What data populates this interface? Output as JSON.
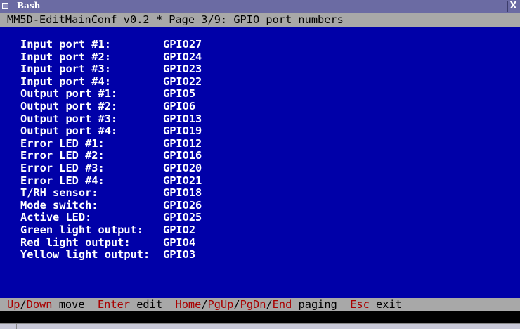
{
  "window": {
    "title": "Bash",
    "close_label": "X"
  },
  "header": {
    "title": "MM5D-EditMainConf v0.2 * Page 3/9: GPIO port numbers"
  },
  "rows": [
    {
      "label": "Input port #1:",
      "value": "GPIO27"
    },
    {
      "label": "Input port #2:",
      "value": "GPIO24"
    },
    {
      "label": "Input port #3:",
      "value": "GPIO23"
    },
    {
      "label": "Input port #4:",
      "value": "GPIO22"
    },
    {
      "label": "Output port #1:",
      "value": "GPIO5"
    },
    {
      "label": "Output port #2:",
      "value": "GPIO6"
    },
    {
      "label": "Output port #3:",
      "value": "GPIO13"
    },
    {
      "label": "Output port #4:",
      "value": "GPIO19"
    },
    {
      "label": "Error LED #1:",
      "value": "GPIO12"
    },
    {
      "label": "Error LED #2:",
      "value": "GPIO16"
    },
    {
      "label": "Error LED #3:",
      "value": "GPIO20"
    },
    {
      "label": "Error LED #4:",
      "value": "GPIO21"
    },
    {
      "label": "T/RH sensor:",
      "value": "GPIO18"
    },
    {
      "label": "Mode switch:",
      "value": "GPIO26"
    },
    {
      "label": "Active LED:",
      "value": "GPIO25"
    },
    {
      "label": "Green light output:",
      "value": "GPIO2"
    },
    {
      "label": "Red light output:",
      "value": "GPIO4"
    },
    {
      "label": "Yellow light output:",
      "value": "GPIO3"
    }
  ],
  "footer": [
    {
      "text": "Up",
      "type": "key"
    },
    {
      "text": "/",
      "type": "txt"
    },
    {
      "text": "Down",
      "type": "key"
    },
    {
      "text": " move  ",
      "type": "txt"
    },
    {
      "text": "Enter",
      "type": "key"
    },
    {
      "text": " edit  ",
      "type": "txt"
    },
    {
      "text": "Home",
      "type": "key"
    },
    {
      "text": "/",
      "type": "txt"
    },
    {
      "text": "PgUp",
      "type": "key"
    },
    {
      "text": "/",
      "type": "txt"
    },
    {
      "text": "PgDn",
      "type": "key"
    },
    {
      "text": "/",
      "type": "txt"
    },
    {
      "text": "End",
      "type": "key"
    },
    {
      "text": " paging  ",
      "type": "txt"
    },
    {
      "text": "Esc",
      "type": "key"
    },
    {
      "text": " exit",
      "type": "txt"
    }
  ],
  "colors": {
    "background": "#0000a8",
    "key": "#a80000",
    "bar": "#a8a8a8"
  }
}
